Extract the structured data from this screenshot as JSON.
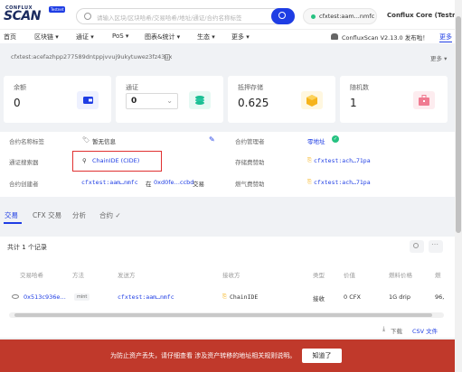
{
  "header": {
    "logo_top": "CONFLUX",
    "logo_main": "SCAN",
    "logo_badge": "Testnet",
    "search_placeholder": "请输入区块/区块哈希/交易哈希/地址/通证/合约名称标签",
    "account_label": "cfxtest:aam...nmfc",
    "network_label": "Conflux Core (Testnet)"
  },
  "nav": {
    "items": [
      "首页",
      "区块链 ▾",
      "通证 ▾",
      "PoS ▾",
      "图表&统计 ▾",
      "生态 ▾",
      "更多 ▾"
    ],
    "version_text": "ConfluxScan V2.13.0 发布啦！",
    "more_link": "更多"
  },
  "address_bar": {
    "address": "cfxtest:acefazhpp277589dntppjvvuj9ukytuwez3fz43ux",
    "more": "更多 ▾"
  },
  "cards": [
    {
      "label": "余额",
      "value": "0",
      "icon": "wallet-icon",
      "color": "#eef1ff"
    },
    {
      "label": "通证",
      "value": "0",
      "icon": "layers-icon",
      "color": "#e6f9f3"
    },
    {
      "label": "抵押存储",
      "value": "0.625",
      "icon": "box-icon",
      "color": "#fff7e0"
    },
    {
      "label": "随机数",
      "value": "1",
      "icon": "briefcase-icon",
      "color": "#fdecef"
    }
  ],
  "contract_info": {
    "name_tag_label": "合约名称标签",
    "name_tag_value": "暂无信息",
    "manager_label": "合约管理者",
    "manager_value": "零地址",
    "token_tracker_label": "通证搜索器",
    "token_tracker_value": "ChainIDE (CIDE)",
    "storage_sponsor_label": "存储费赞助",
    "storage_sponsor_value": "cfxtest:ach…71pa",
    "creator_label": "合约创建者",
    "creator_addr": "cfxtest:aam…nmfc",
    "creator_at": "在",
    "creator_tx": "0xd0fe…ccbd",
    "creator_suffix": "交易",
    "gas_sponsor_label": "燃气费赞助",
    "gas_sponsor_value": "cfxtest:ach…71pa"
  },
  "tabs": [
    "交易",
    "CFX 交易",
    "分析",
    "合约 ✓"
  ],
  "tx_table": {
    "count": "共计 1 个记录",
    "headers": [
      "交易哈希",
      "方法",
      "发送方",
      "接收方",
      "类型",
      "价值",
      "燃料价格",
      "燃"
    ],
    "row": {
      "hash": "0x513c936e…",
      "method": "mint",
      "from": "cfxtest:aam…nmfc",
      "to": "ChainIDE",
      "type": "接收",
      "value": "0 CFX",
      "gas_price": "1G drip",
      "gas": "96,"
    },
    "download": "下载",
    "csv": "CSV 文件"
  },
  "banner": {
    "text": "为防止资产丢失，请仔细查看 涉及资产转移的地址相关规则说明。",
    "button": "知道了"
  }
}
